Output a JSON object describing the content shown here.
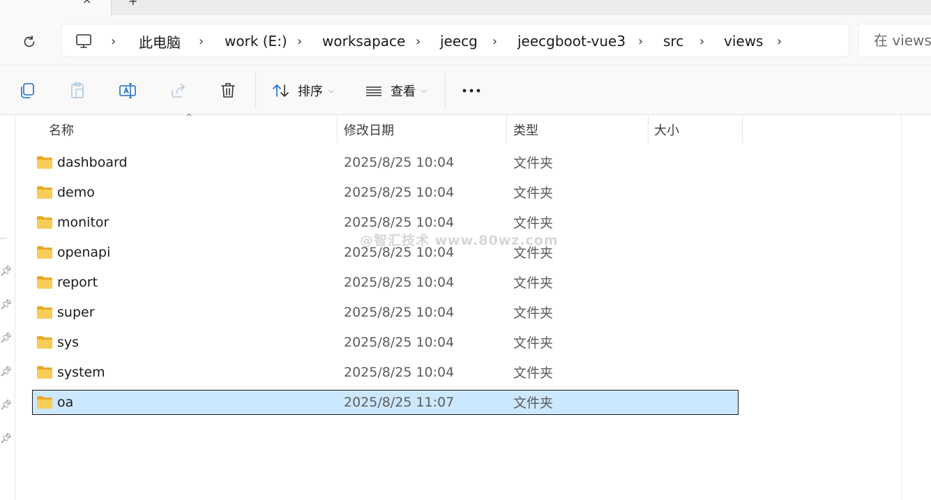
{
  "breadcrumb": {
    "segments": [
      "此电脑",
      "work (E:)",
      "worksapace",
      "jeecg",
      "jeecgboot-vue3",
      "src",
      "views"
    ]
  },
  "search": {
    "placeholder": "在 views"
  },
  "commandbar": {
    "sort_label": "排序",
    "view_label": "查看"
  },
  "columns": {
    "name": "名称",
    "date": "修改日期",
    "type": "类型",
    "size": "大小"
  },
  "files": [
    {
      "name": "dashboard",
      "date": "2025/8/25 10:04",
      "type": "文件夹"
    },
    {
      "name": "demo",
      "date": "2025/8/25 10:04",
      "type": "文件夹"
    },
    {
      "name": "monitor",
      "date": "2025/8/25 10:04",
      "type": "文件夹"
    },
    {
      "name": "openapi",
      "date": "2025/8/25 10:04",
      "type": "文件夹"
    },
    {
      "name": "report",
      "date": "2025/8/25 10:04",
      "type": "文件夹"
    },
    {
      "name": "super",
      "date": "2025/8/25 10:04",
      "type": "文件夹"
    },
    {
      "name": "sys",
      "date": "2025/8/25 10:04",
      "type": "文件夹"
    },
    {
      "name": "system",
      "date": "2025/8/25 10:04",
      "type": "文件夹"
    },
    {
      "name": "oa",
      "date": "2025/8/25 11:07",
      "type": "文件夹",
      "selected": true
    }
  ],
  "watermark": "@智汇技术 www.80wz.com",
  "colors": {
    "selection": "#cce8ff",
    "folder": "#f5c443"
  }
}
